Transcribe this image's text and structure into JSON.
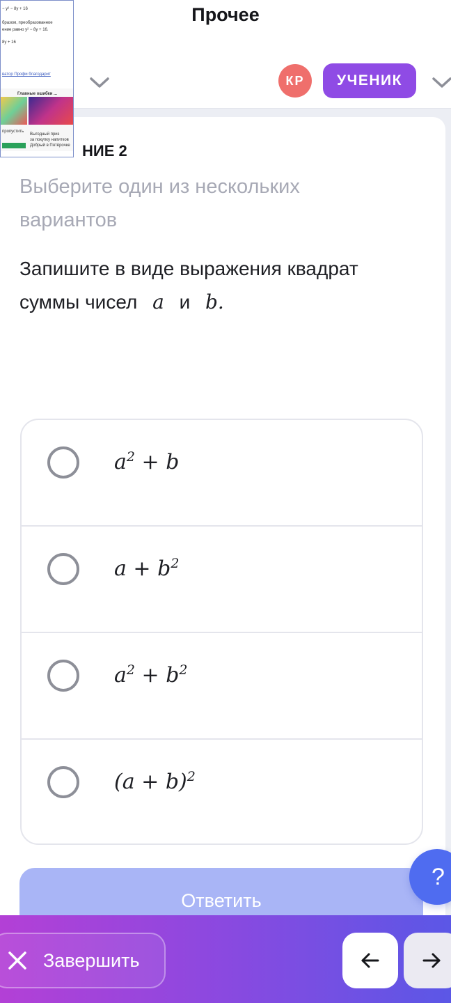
{
  "header": {
    "title": "Прочее",
    "avatar_initials": "КР",
    "role_label": "УЧЕНИК"
  },
  "task": {
    "label_visible": "НИЕ 2",
    "instruction": "Выберите один из нескольких вариантов",
    "question_prefix": "Запишите в виде выражения квадрат суммы чисел",
    "question_var_a": "a",
    "question_and": "и",
    "question_var_b": "b."
  },
  "options": [
    {
      "base1": "a",
      "sup1": "2",
      "op": " + ",
      "base2": "b",
      "sup2": ""
    },
    {
      "base1": "a",
      "sup1": "",
      "op": " + ",
      "base2": "b",
      "sup2": "2"
    },
    {
      "base1": "a",
      "sup1": "2",
      "op": " + ",
      "base2": "b",
      "sup2": "2"
    },
    {
      "paren_open": "(",
      "base1": "a",
      "op": " + ",
      "base2": "b",
      "paren_close": ")",
      "sup": "2"
    }
  ],
  "answer_button": "Ответить",
  "help_button": "?",
  "bottom_bar": {
    "finish_label": "Завершить"
  },
  "thumbnail": {
    "line1": "− y² − 8y + 16",
    "line2": "бразом, преобразованное",
    "line3": "ение равно y² − 8y + 16.",
    "line4": "8y + 16",
    "line5": "ватор Профи благодарит",
    "ad_title": "Главные ошибки ...",
    "ad_left": "пропустить",
    "ad_right1": "Выгодный приз",
    "ad_right2": "за покупку напитков",
    "ad_right3": "Добрый в Пятёрочке"
  },
  "colors": {
    "accent": "#8f4be5",
    "avatar": "#ef6f6c",
    "help": "#4f6cf0",
    "answer_disabled": "#a9b5f6"
  }
}
